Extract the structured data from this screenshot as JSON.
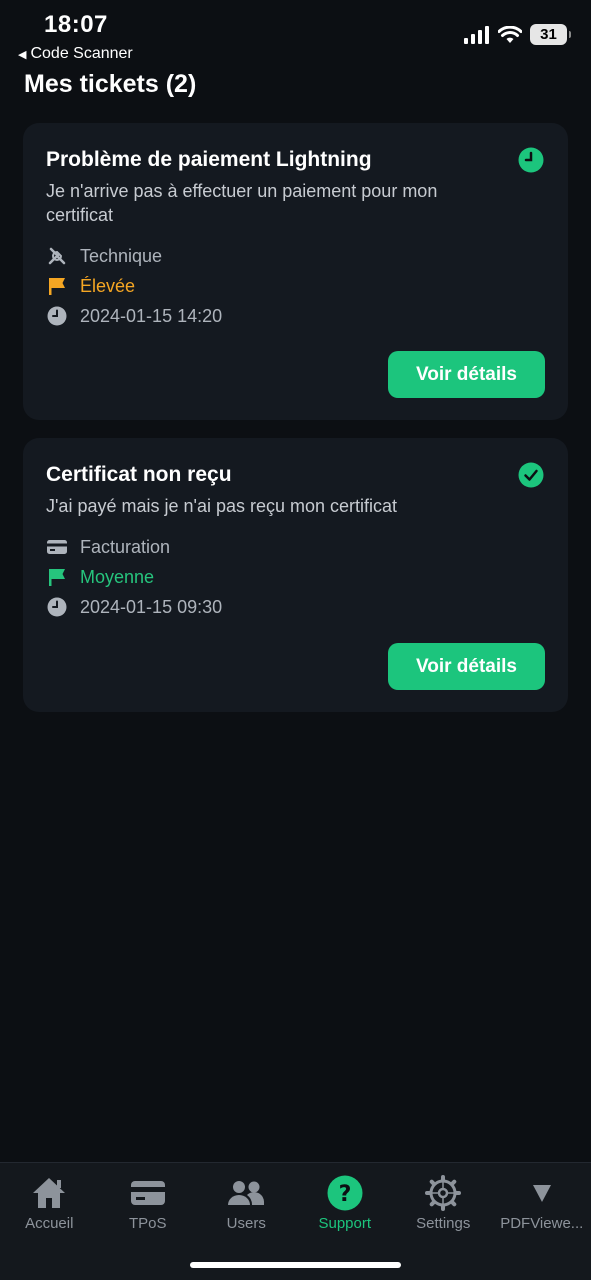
{
  "status_bar": {
    "time": "18:07",
    "back_label": "Code Scanner",
    "battery": "31"
  },
  "page": {
    "title": "Mes tickets (2)"
  },
  "tickets": [
    {
      "title": "Problème de paiement Lightning",
      "description": "Je n'arrive pas à effectuer un paiement pour mon certificat",
      "status_icon": "clock-icon",
      "category": "Technique",
      "category_icon": "tools-icon",
      "priority": "Élevée",
      "priority_color": "#f5a623",
      "date": "2024-01-15 14:20",
      "button_label": "Voir détails"
    },
    {
      "title": "Certificat non reçu",
      "description": "J'ai payé mais je n'ai pas reçu mon certificat",
      "status_icon": "check-circle-icon",
      "category": "Facturation",
      "category_icon": "card-icon",
      "priority": "Moyenne",
      "priority_color": "#26c47d",
      "date": "2024-01-15 09:30",
      "button_label": "Voir détails"
    }
  ],
  "tab_bar": {
    "active_color": "#1cc57d",
    "items": [
      {
        "label": "Accueil",
        "icon": "home-icon"
      },
      {
        "label": "TPoS",
        "icon": "card-icon"
      },
      {
        "label": "Users",
        "icon": "users-icon"
      },
      {
        "label": "Support",
        "icon": "help-icon",
        "active": true
      },
      {
        "label": "Settings",
        "icon": "gear-icon"
      },
      {
        "label": "PDFViewe...",
        "icon": "triangle-down-icon"
      }
    ]
  }
}
